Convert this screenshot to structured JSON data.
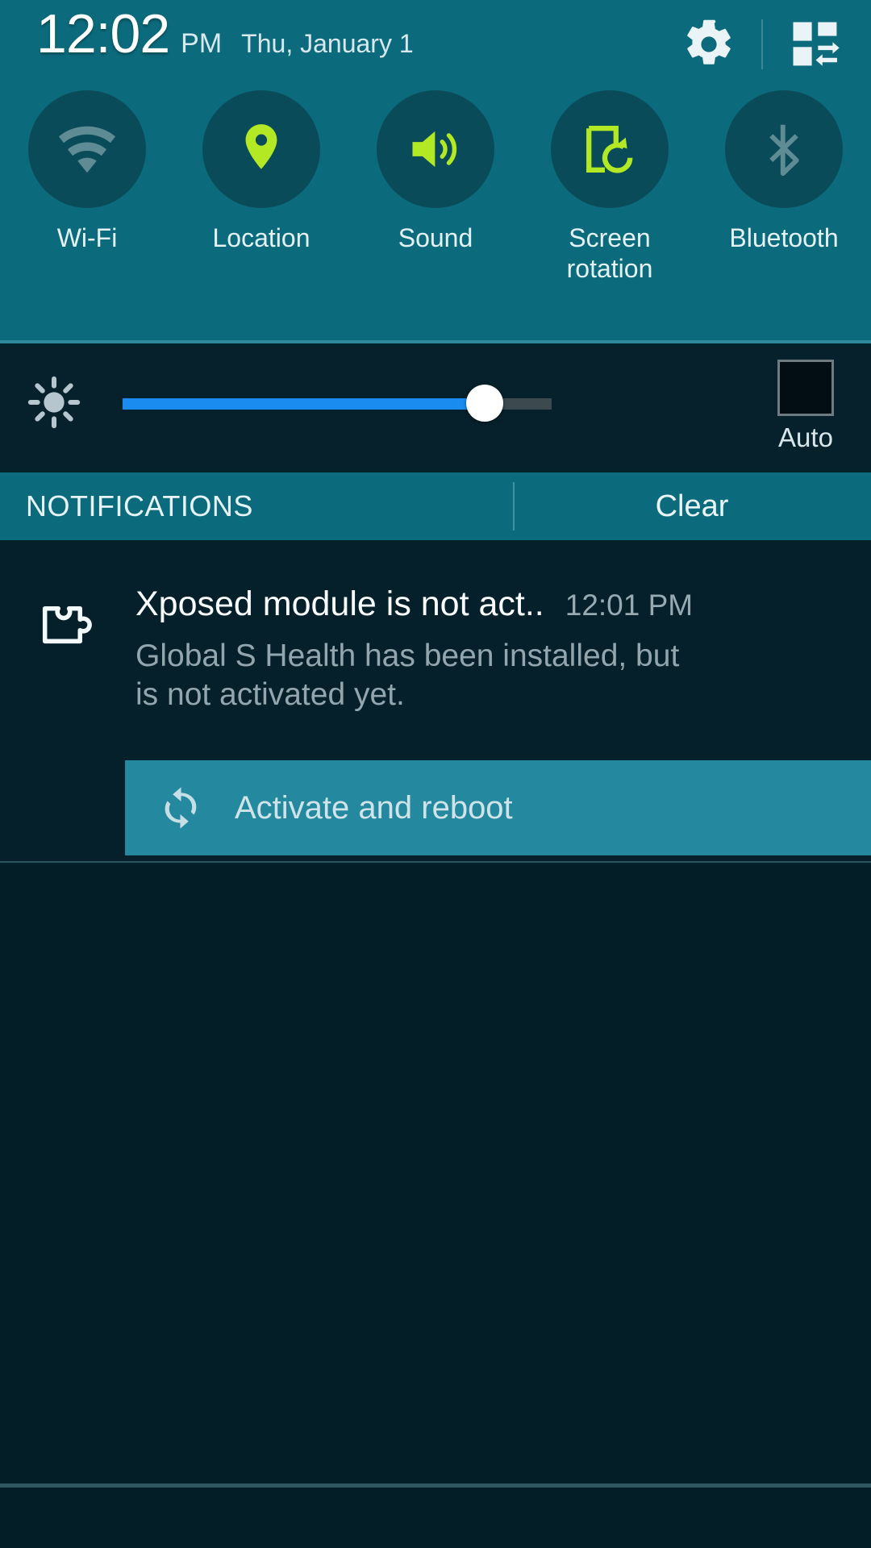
{
  "theme": {
    "panel_teal": "#0B6B7C",
    "circle_teal": "#0A4B59",
    "active_green": "#B2E824",
    "inactive_gray": "#5F8B94",
    "dark_bg": "#05202A",
    "slider_blue": "#1A8CF0",
    "action_teal": "#24899F"
  },
  "status_bar": {
    "time": "12:02",
    "ampm": "PM",
    "date": "Thu, January 1",
    "settings_icon": "gear-icon",
    "quick_settings_icon": "quick-settings-grid-icon"
  },
  "quick_toggles": [
    {
      "label": "Wi-Fi",
      "icon": "wifi-icon",
      "active": false
    },
    {
      "label": "Location",
      "icon": "location-pin-icon",
      "active": true
    },
    {
      "label": "Sound",
      "icon": "sound-speaker-icon",
      "active": true
    },
    {
      "label": "Screen rotation",
      "icon": "screen-rotation-icon",
      "active": true
    },
    {
      "label": "Bluetooth",
      "icon": "bluetooth-icon",
      "active": false
    }
  ],
  "brightness": {
    "icon": "brightness-sun-icon",
    "value_percent": 84,
    "auto_label": "Auto",
    "auto_checked": false
  },
  "notifications_bar": {
    "title": "NOTIFICATIONS",
    "clear_label": "Clear"
  },
  "notification": {
    "icon": "xposed-puzzle-icon",
    "title": "Xposed module is not act..",
    "time": "12:01 PM",
    "body": "Global S Health has been installed, but is not activated yet.",
    "action": {
      "icon": "refresh-sync-icon",
      "label": "Activate and reboot"
    }
  }
}
